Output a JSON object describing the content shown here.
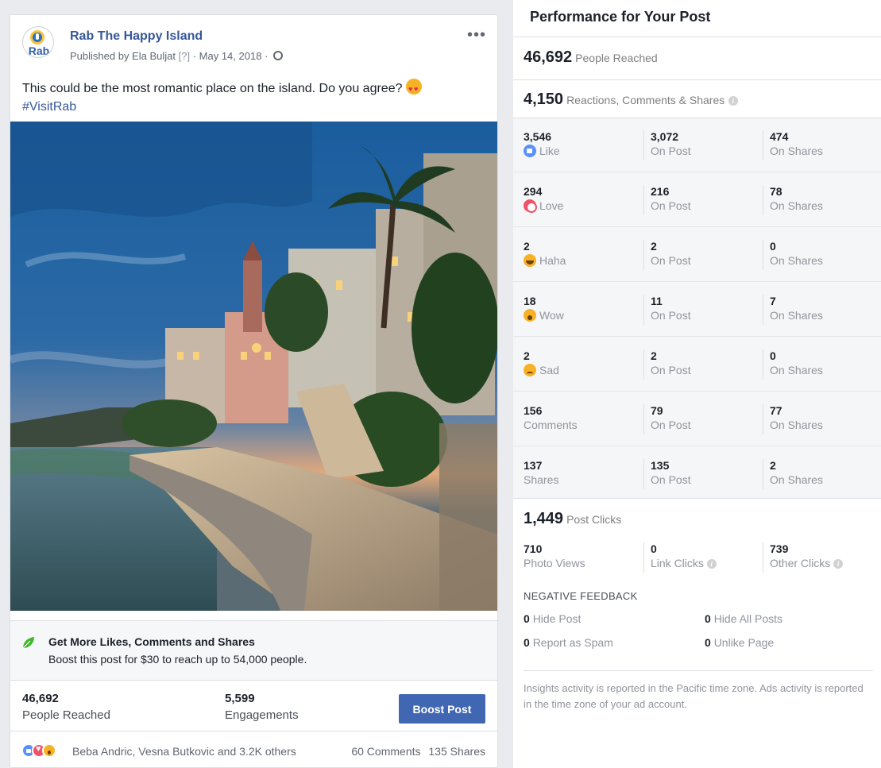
{
  "post": {
    "page_name": "Rab The Happy Island",
    "avatar_text": "Rab",
    "published_by": "Published by Ela Buljat",
    "help_mark": "[?]",
    "date": "· May 14, 2018 ·",
    "text": "This could be the most romantic place on the island. Do you agree?",
    "hashtag": "#VisitRab",
    "more_label": "•••"
  },
  "promo": {
    "title": "Get More Likes, Comments and Shares",
    "subtitle": "Boost this post for $30 to reach up to 54,000 people."
  },
  "stats": {
    "reached_value": "46,692",
    "reached_label": "People Reached",
    "engagements_value": "5,599",
    "engagements_label": "Engagements",
    "boost_label": "Boost Post"
  },
  "reactions": {
    "names": "Beba Andric, Vesna Butkovic and 3.2K others",
    "comments": "60 Comments",
    "shares": "135 Shares"
  },
  "performance": {
    "title": "Performance for Your Post",
    "reached_value": "46,692",
    "reached_label": "People Reached",
    "rcs_value": "4,150",
    "rcs_label": "Reactions, Comments & Shares",
    "rows": [
      {
        "total": "3,546",
        "label": "Like",
        "icon": "like",
        "on_post": "3,072",
        "on_shares": "474"
      },
      {
        "total": "294",
        "label": "Love",
        "icon": "love",
        "on_post": "216",
        "on_shares": "78"
      },
      {
        "total": "2",
        "label": "Haha",
        "icon": "haha",
        "on_post": "2",
        "on_shares": "0"
      },
      {
        "total": "18",
        "label": "Wow",
        "icon": "wow",
        "on_post": "11",
        "on_shares": "7"
      },
      {
        "total": "2",
        "label": "Sad",
        "icon": "sad",
        "on_post": "2",
        "on_shares": "0"
      },
      {
        "total": "156",
        "label": "Comments",
        "icon": "",
        "on_post": "79",
        "on_shares": "77"
      },
      {
        "total": "137",
        "label": "Shares",
        "icon": "",
        "on_post": "135",
        "on_shares": "2"
      }
    ],
    "on_post_label": "On Post",
    "on_shares_label": "On Shares",
    "post_clicks_value": "1,449",
    "post_clicks_label": "Post Clicks",
    "photo_views_value": "710",
    "photo_views_label": "Photo Views",
    "link_clicks_value": "0",
    "link_clicks_label": "Link Clicks",
    "other_clicks_value": "739",
    "other_clicks_label": "Other Clicks",
    "negative_title": "NEGATIVE FEEDBACK",
    "hide_post_value": "0",
    "hide_post_label": "Hide Post",
    "hide_all_value": "0",
    "hide_all_label": "Hide All Posts",
    "spam_value": "0",
    "spam_label": "Report as Spam",
    "unlike_value": "0",
    "unlike_label": "Unlike Page",
    "footnote": "Insights activity is reported in the Pacific time zone. Ads activity is reported in the time zone of your ad account."
  },
  "colors": {
    "link": "#365899",
    "button": "#4267b2",
    "like": "#5890ff",
    "love": "#f25268",
    "emoji": "#f7b125"
  }
}
